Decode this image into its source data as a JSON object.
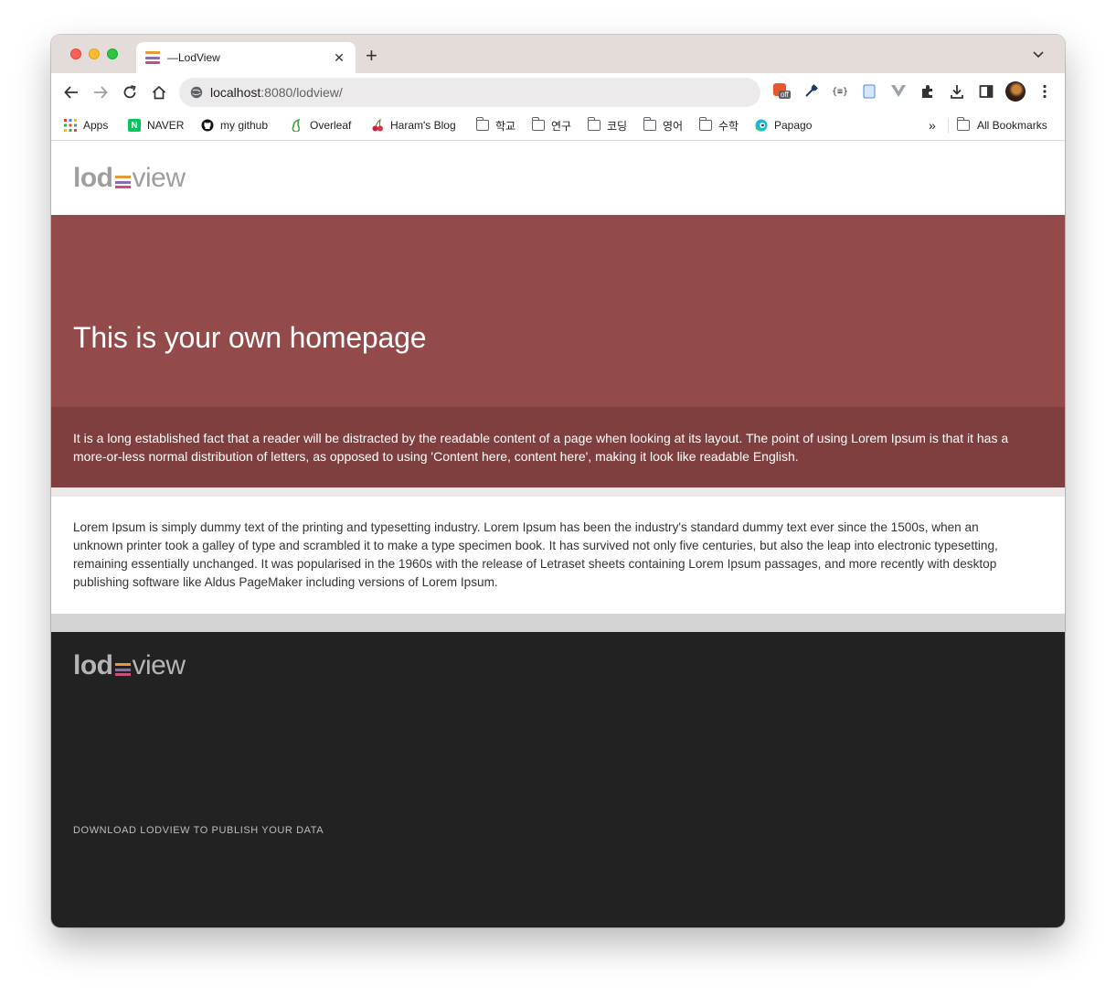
{
  "browser": {
    "tab": {
      "title": "—LodView",
      "close": "✕"
    },
    "new_tab": "+",
    "address": {
      "host": "localhost",
      "path": ":8080/lodview/"
    },
    "extensions": {
      "badge": "off"
    },
    "bookmarks": [
      {
        "label": "Apps",
        "icon": "apps-grid-icon"
      },
      {
        "label": "NAVER",
        "icon": "naver-icon"
      },
      {
        "label": "my github",
        "icon": "github-icon"
      },
      {
        "label": "Overleaf",
        "icon": "overleaf-icon"
      },
      {
        "label": "Haram's Blog",
        "icon": "cherry-icon"
      },
      {
        "label": "학교",
        "icon": "folder-icon"
      },
      {
        "label": "연구",
        "icon": "folder-icon"
      },
      {
        "label": "코딩",
        "icon": "folder-icon"
      },
      {
        "label": "영어",
        "icon": "folder-icon"
      },
      {
        "label": "수학",
        "icon": "folder-icon"
      },
      {
        "label": "Papago",
        "icon": "papago-icon"
      }
    ],
    "overflow": "»",
    "all_bookmarks": "All Bookmarks"
  },
  "page": {
    "logo": {
      "part1": "lod",
      "part2": "view"
    },
    "hero": {
      "title": "This is your own homepage",
      "description": "It is a long established fact that a reader will be distracted by the readable content of a page when looking at its layout. The point of using Lorem Ipsum is that it has a more-or-less normal distribution of letters, as opposed to using 'Content here, content here', making it look like readable English."
    },
    "content": {
      "text": "Lorem Ipsum is simply dummy text of the printing and typesetting industry. Lorem Ipsum has been the industry's standard dummy text ever since the 1500s, when an unknown printer took a galley of type and scrambled it to make a type specimen book. It has survived not only five centuries, but also the leap into electronic typesetting, remaining essentially unchanged. It was popularised in the 1960s with the release of Letraset sheets containing Lorem Ipsum passages, and more recently with desktop publishing software like Aldus PageMaker including versions of Lorem Ipsum."
    },
    "footer": {
      "logo": {
        "part1": "lod",
        "part2": "view"
      },
      "link": "DOWNLOAD LODVIEW TO PUBLISH YOUR DATA"
    }
  },
  "colors": {
    "hero": "#924a4a",
    "hero_desc": "#803f3f",
    "footer": "#222222",
    "logo_bar_1": "#e59a3a",
    "logo_bar_2": "#8a6db0",
    "logo_bar_3": "#c9507b"
  }
}
